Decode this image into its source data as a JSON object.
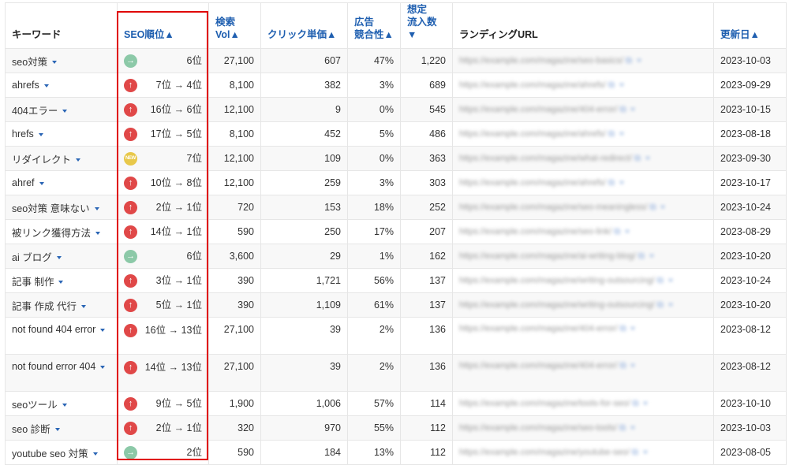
{
  "headers": {
    "keyword": "キーワード",
    "seo_rank": "SEO順位▲",
    "volume": "検索Vol▲",
    "cpc": "クリック単価▲",
    "competition_line1": "広告",
    "competition_line2": "競合性▲",
    "traffic_line1": "想定",
    "traffic_line2": "流入数▼",
    "landing_url": "ランディングURL",
    "updated": "更新日▲"
  },
  "icons": {
    "up": "↑",
    "same": "→",
    "new": "NEW",
    "external_link": "⧉"
  },
  "rows": [
    {
      "keyword": "seo対策",
      "status": "same",
      "rank": "6位",
      "volume": "27,100",
      "cpc": "607",
      "competition": "47%",
      "traffic": "1,220",
      "url": "https://example.com/magazine/seo-basics/",
      "date": "2023-10-03"
    },
    {
      "keyword": "ahrefs",
      "status": "up",
      "rank": "7位 → 4位",
      "volume": "8,100",
      "cpc": "382",
      "competition": "3%",
      "traffic": "689",
      "url": "https://example.com/magazine/ahrefs/",
      "date": "2023-09-29"
    },
    {
      "keyword": "404エラー",
      "status": "up",
      "rank": "16位 → 6位",
      "volume": "12,100",
      "cpc": "9",
      "competition": "0%",
      "traffic": "545",
      "url": "https://example.com/magazine/404-error/",
      "date": "2023-10-15"
    },
    {
      "keyword": "hrefs",
      "status": "up",
      "rank": "17位 → 5位",
      "volume": "8,100",
      "cpc": "452",
      "competition": "5%",
      "traffic": "486",
      "url": "https://example.com/magazine/ahrefs/",
      "date": "2023-08-18"
    },
    {
      "keyword": "リダイレクト",
      "status": "new",
      "rank": "7位",
      "volume": "12,100",
      "cpc": "109",
      "competition": "0%",
      "traffic": "363",
      "url": "https://example.com/magazine/what-redirect/",
      "date": "2023-09-30"
    },
    {
      "keyword": "ahref",
      "status": "up",
      "rank": "10位 → 8位",
      "volume": "12,100",
      "cpc": "259",
      "competition": "3%",
      "traffic": "303",
      "url": "https://example.com/magazine/ahrefs/",
      "date": "2023-10-17"
    },
    {
      "keyword": "seo対策 意味ない",
      "status": "up",
      "rank": "2位 → 1位",
      "volume": "720",
      "cpc": "153",
      "competition": "18%",
      "traffic": "252",
      "url": "https://example.com/magazine/seo-meaningless/",
      "date": "2023-10-24"
    },
    {
      "keyword": "被リンク獲得方法",
      "status": "up",
      "rank": "14位 → 1位",
      "volume": "590",
      "cpc": "250",
      "competition": "17%",
      "traffic": "207",
      "url": "https://example.com/magazine/seo-link/",
      "date": "2023-08-29"
    },
    {
      "keyword": "ai ブログ",
      "status": "same",
      "rank": "6位",
      "volume": "3,600",
      "cpc": "29",
      "competition": "1%",
      "traffic": "162",
      "url": "https://example.com/magazine/ai-writing-blog/",
      "date": "2023-10-20"
    },
    {
      "keyword": "記事 制作",
      "status": "up",
      "rank": "3位 → 1位",
      "volume": "390",
      "cpc": "1,721",
      "competition": "56%",
      "traffic": "137",
      "url": "https://example.com/magazine/writing-outsourcing/",
      "date": "2023-10-24"
    },
    {
      "keyword": "記事 作成 代行",
      "status": "up",
      "rank": "5位 → 1位",
      "volume": "390",
      "cpc": "1,109",
      "competition": "61%",
      "traffic": "137",
      "url": "https://example.com/magazine/writing-outsourcing/",
      "date": "2023-10-20"
    },
    {
      "keyword": "not found 404 error",
      "status": "up",
      "rank": "16位 → 13位",
      "volume": "27,100",
      "cpc": "39",
      "competition": "2%",
      "traffic": "136",
      "url": "https://example.com/magazine/404-error/",
      "date": "2023-08-12",
      "tall": true
    },
    {
      "keyword": "not found error 404",
      "status": "up",
      "rank": "14位 → 13位",
      "volume": "27,100",
      "cpc": "39",
      "competition": "2%",
      "traffic": "136",
      "url": "https://example.com/magazine/404-error/",
      "date": "2023-08-12",
      "tall": true
    },
    {
      "keyword": "seoツール",
      "status": "up",
      "rank": "9位 → 5位",
      "volume": "1,900",
      "cpc": "1,006",
      "competition": "57%",
      "traffic": "114",
      "url": "https://example.com/magazine/tools-for-seo/",
      "date": "2023-10-10"
    },
    {
      "keyword": "seo 診断",
      "status": "up",
      "rank": "2位 → 1位",
      "volume": "320",
      "cpc": "970",
      "competition": "55%",
      "traffic": "112",
      "url": "https://example.com/magazine/seo-tools/",
      "date": "2023-10-03"
    },
    {
      "keyword": "youtube seo 対策",
      "status": "same",
      "rank": "2位",
      "volume": "590",
      "cpc": "184",
      "competition": "13%",
      "traffic": "112",
      "url": "https://example.com/magazine/youtube-seo/",
      "date": "2023-08-05"
    }
  ]
}
